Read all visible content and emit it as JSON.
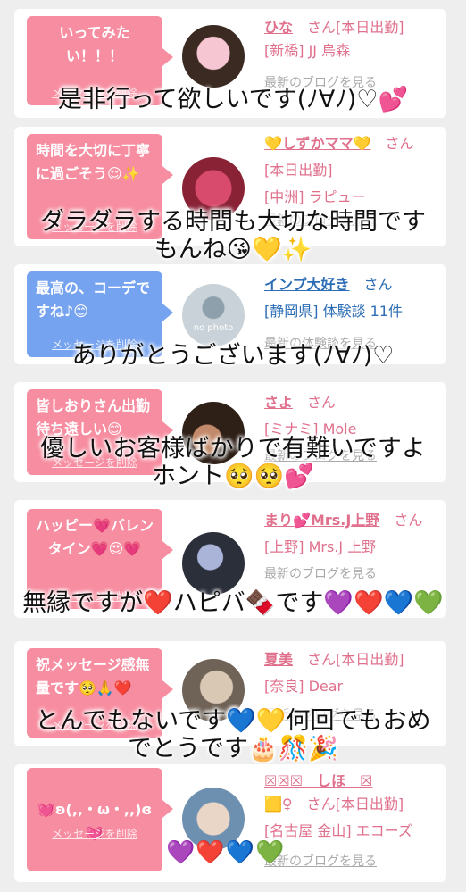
{
  "colors": {
    "accent_pink": "#f78da0",
    "accent_blue": "#76a3f0",
    "link_pink": "#e0708c",
    "link_blue": "#2c6db5"
  },
  "delete_label": "メッセージを削除",
  "cards": [
    {
      "message": "いってみたい！！！",
      "name": "ひな",
      "san": "さん[本日出勤]",
      "sub1": "[新橋] JJ 烏森",
      "sub2": "",
      "link": "最新のブログを見る"
    },
    {
      "message": "時間を大切に丁寧に過ごそう😌✨",
      "name": "💛しずかママ💛",
      "san": "さん",
      "sub1": "[本日出勤]",
      "sub2": "[中洲] ラピュー",
      "link": "最新のブログを見る"
    },
    {
      "message": "最高の、コーデですね♪😊",
      "name": "インプ大好き",
      "san": "さん",
      "sub1": "[静岡県] 体験談 11件",
      "sub2": "",
      "link": "最新の体験談を見る",
      "avatar_text": "no photo"
    },
    {
      "message": "皆しおりさん出勤待ち遠しい😊",
      "name": "さよ",
      "san": "さん",
      "sub1": "[ミナミ] Mole",
      "sub2": "",
      "link": "最新のブログを見る"
    },
    {
      "message": "ハッピー💗バレンタイン💗😍💗",
      "name": "まり💕Mrs.J上野",
      "san": "さん",
      "sub1": "[上野] Mrs.J 上野",
      "sub2": "",
      "link": "最新のブログを見る"
    },
    {
      "message": "祝メッセージ感無量です🥺🙏❤️",
      "name": "夏美",
      "san": "さん[本日出勤]",
      "sub1": "[奈良] Dear",
      "sub2": "",
      "link": "最新のブログを見る"
    },
    {
      "message": "💓ʚ(,,・ω・,,)ɞ💓",
      "name": "☒☒☒　しほ　☒",
      "san": "さん[本日出勤]",
      "name_line2": "🟨♀",
      "sub1": "[名古屋 金山] エコーズ",
      "sub2": "",
      "link": "最新のブログを見る"
    }
  ],
  "overlays": [
    "是非行って欲しいです(ﾉ∀ﾉ)♡💕",
    "ダラダラする時間も大切な時間です\nもんね😘💛✨",
    "ありがとうございます(ﾉ∀ﾉ)♡",
    "優しいお客様ばかりで有難いですよ\nホント🥺🥺💕",
    "無縁ですが❤️ハピバ🍫です💜❤️💙💚",
    "とんでもないです💙💛何回でもおめ\nでとうです🎂🎊🎉",
    "💜❤️💙💚"
  ]
}
